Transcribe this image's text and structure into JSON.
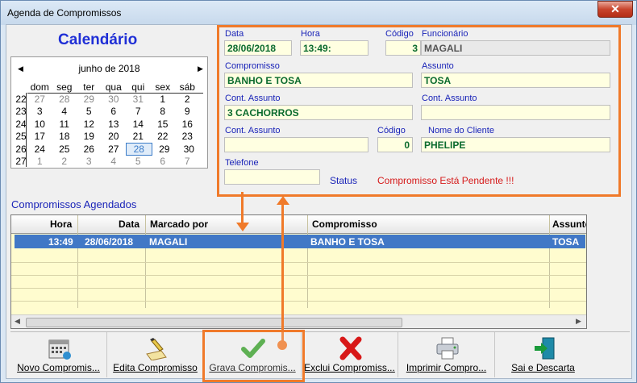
{
  "window": {
    "title": "Agenda de Compromissos",
    "close_glyph": "✕"
  },
  "calendar": {
    "title": "Calendário",
    "month": "junho de 2018",
    "prev": "◀",
    "next": "▶",
    "days": [
      "dom",
      "seg",
      "ter",
      "qua",
      "qui",
      "sex",
      "sáb"
    ],
    "weeks": [
      {
        "wk": "22",
        "d": [
          "27",
          "28",
          "29",
          "30",
          "31",
          "1",
          "2"
        ],
        "grey": [
          0,
          1,
          2,
          3,
          4
        ]
      },
      {
        "wk": "23",
        "d": [
          "3",
          "4",
          "5",
          "6",
          "7",
          "8",
          "9"
        ],
        "grey": []
      },
      {
        "wk": "24",
        "d": [
          "10",
          "11",
          "12",
          "13",
          "14",
          "15",
          "16"
        ],
        "grey": []
      },
      {
        "wk": "25",
        "d": [
          "17",
          "18",
          "19",
          "20",
          "21",
          "22",
          "23"
        ],
        "grey": []
      },
      {
        "wk": "26",
        "d": [
          "24",
          "25",
          "26",
          "27",
          "28",
          "29",
          "30"
        ],
        "grey": [],
        "today": 4
      },
      {
        "wk": "27",
        "d": [
          "1",
          "2",
          "3",
          "4",
          "5",
          "6",
          "7"
        ],
        "grey": [
          0,
          1,
          2,
          3,
          4,
          5,
          6
        ]
      }
    ]
  },
  "form": {
    "data_label": "Data",
    "data_value": "28/06/2018",
    "hora_label": "Hora",
    "hora_value": "13:49:",
    "codigo_label": "Código",
    "codigo_value": "3",
    "funcionario_label": "Funcionário",
    "funcionario_value": "MAGALI",
    "compromisso_label": "Compromisso",
    "compromisso_value": "BANHO E TOSA",
    "assunto_label": "Assunto",
    "assunto_value": "TOSA",
    "cont_assunto1_label": "Cont. Assunto",
    "cont_assunto1_value": "3 CACHORROS",
    "cont_assunto2_label": "Cont. Assunto",
    "cont_assunto2_value": "",
    "cont_assunto3_label": "Cont. Assunto",
    "cont_assunto3_value": "",
    "codigo2_label": "Código",
    "codigo2_value": "0",
    "cliente_label": "Nome do Cliente",
    "cliente_value": "PHELIPE",
    "telefone_label": "Telefone",
    "telefone_value": "",
    "status_label": "Status",
    "status_value": "Compromisso Está Pendente !!!"
  },
  "grid": {
    "title": "Compromissos Agendados",
    "headers": [
      "Hora",
      "Data",
      "Marcado por",
      "Compromisso",
      "Assunto"
    ],
    "row": [
      "13:49",
      "28/06/2018",
      "MAGALI",
      "BANHO E TOSA",
      "TOSA"
    ]
  },
  "toolbar": {
    "novo": "Novo Compromis...",
    "edita": "Edita Compromisso",
    "grava": "Grava Compromis...",
    "exclui": "Exclui Compromiss...",
    "imprimir": "Imprimir Compro...",
    "sai": "Sai e Descarta"
  },
  "colors": {
    "accent_orange": "#f07a2a",
    "label_blue": "#1a24b8",
    "value_green": "#0b6b2e",
    "status_red": "#d61a1a"
  }
}
